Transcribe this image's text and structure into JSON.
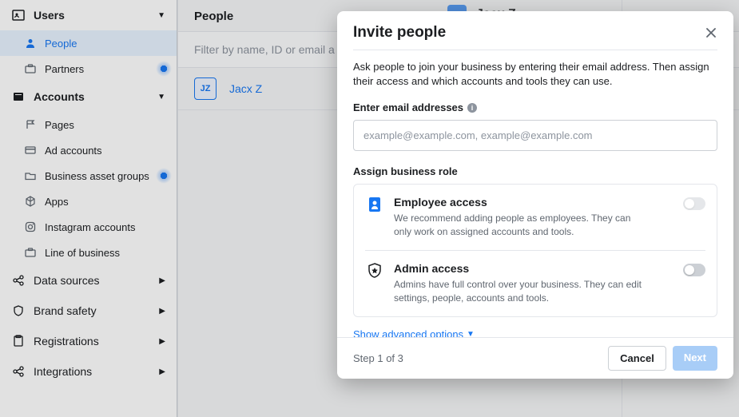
{
  "sidebar": {
    "groups": [
      {
        "label": "Users",
        "expanded": true,
        "icon": "users-icon",
        "items": [
          {
            "label": "People",
            "active": true,
            "icon": "person-icon",
            "pulse": false
          },
          {
            "label": "Partners",
            "active": false,
            "icon": "briefcase-icon",
            "pulse": true
          }
        ]
      },
      {
        "label": "Accounts",
        "expanded": true,
        "icon": "folder-icon",
        "items": [
          {
            "label": "Pages",
            "icon": "flag-icon",
            "pulse": false
          },
          {
            "label": "Ad accounts",
            "icon": "card-icon",
            "pulse": false
          },
          {
            "label": "Business asset groups",
            "icon": "folder2-icon",
            "pulse": true
          },
          {
            "label": "Apps",
            "icon": "cube-icon",
            "pulse": false
          },
          {
            "label": "Instagram accounts",
            "icon": "instagram-icon",
            "pulse": false
          },
          {
            "label": "Line of business",
            "icon": "briefcase-icon",
            "pulse": false
          }
        ]
      }
    ],
    "collapsed": [
      {
        "label": "Data sources",
        "icon": "share-icon"
      },
      {
        "label": "Brand safety",
        "icon": "shield-icon"
      },
      {
        "label": "Registrations",
        "icon": "clipboard-icon"
      },
      {
        "label": "Integrations",
        "icon": "share-icon"
      }
    ]
  },
  "main": {
    "header": "People",
    "filter_placeholder": "Filter by name, ID or email a",
    "list": [
      {
        "initials": "JZ",
        "name": "Jacx Z"
      }
    ],
    "behind_name": "Jacx Z"
  },
  "modal": {
    "title": "Invite people",
    "description": "Ask people to join your business by entering their email address. Then assign their access and which accounts and tools they can use.",
    "email_label": "Enter email addresses",
    "email_placeholder": "example@example.com, example@example.com",
    "assign_label": "Assign business role",
    "roles": [
      {
        "title": "Employee access",
        "desc": "We recommend adding people as employees. They can only work on assigned accounts and tools.",
        "icon": "id-badge-icon",
        "toggle_on": false,
        "toggle_disabled": true
      },
      {
        "title": "Admin access",
        "desc": "Admins have full control over your business. They can edit settings, people, accounts and tools.",
        "icon": "shield-star-icon",
        "toggle_on": false,
        "toggle_disabled": false
      }
    ],
    "advanced": "Show advanced options",
    "step": "Step 1 of 3",
    "cancel": "Cancel",
    "next": "Next"
  }
}
